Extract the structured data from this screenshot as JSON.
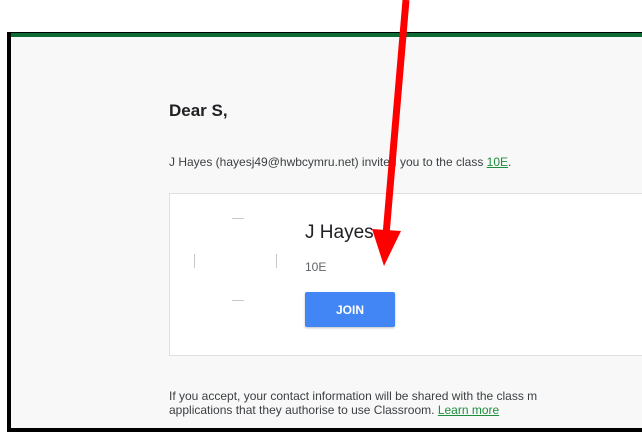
{
  "email": {
    "greeting": "Dear S,",
    "invite": {
      "prefix": "J Hayes (hayesj49@hwbcymru.net) invited you to the class ",
      "class_link": "10E",
      "suffix": "."
    },
    "card": {
      "teacher_name": "J Hayes",
      "class_name": "10E",
      "join_label": "JOIN"
    },
    "footer": {
      "line1": "If you accept, your contact information will be shared with the class m",
      "line2_prefix": "applications that they authorise to use Classroom. ",
      "learn_more": "Learn more"
    }
  },
  "annotation": {
    "arrow_color": "#ff0000",
    "icon": "red-arrow-pointing-to-join"
  },
  "colors": {
    "header_bar": "#0f6b34",
    "join_button": "#4285f4",
    "link": "#1e8e3e"
  }
}
